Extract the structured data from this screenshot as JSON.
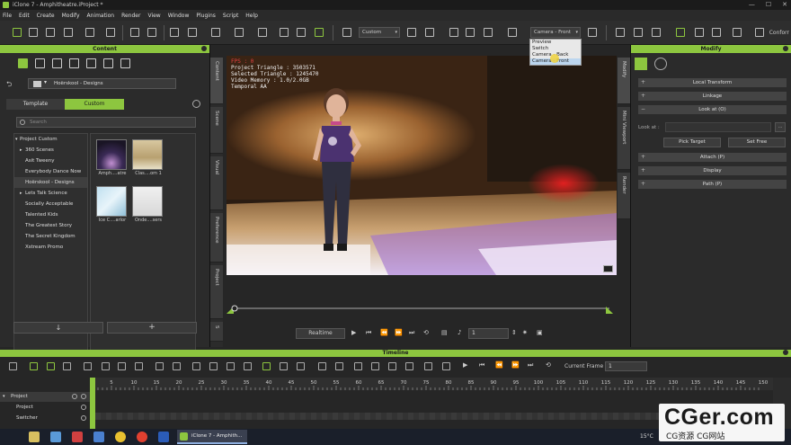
{
  "window": {
    "title": "iClone 7 - Amphitheatre.iProject *",
    "controls": [
      "—",
      "☐",
      "✕"
    ]
  },
  "menu": [
    "File",
    "Edit",
    "Create",
    "Modify",
    "Animation",
    "Render",
    "View",
    "Window",
    "Plugins",
    "Script",
    "Help"
  ],
  "toolbar": {
    "view_mode": "Custom",
    "camera": "Camera - Front",
    "conform_label": "Conforr",
    "camera_options": [
      "Preview",
      "Switch",
      "Camera - Back",
      "Camera - Front"
    ],
    "accent": "#8dc63f"
  },
  "content_panel": {
    "title": "Content",
    "path": "Hoërskool - Designs",
    "tabs": [
      "Template",
      "Custom"
    ],
    "active_tab": "Custom",
    "search_placeholder": "Search",
    "tree": [
      {
        "label": "Project Custom",
        "expander": "▾",
        "level": 0
      },
      {
        "label": "360 Scenes",
        "expander": "▸",
        "level": 1
      },
      {
        "label": "Asit Tweeny",
        "expander": "",
        "level": 1
      },
      {
        "label": "Everybody Dance Now",
        "expander": "",
        "level": 1
      },
      {
        "label": "Hoërskool - Designs",
        "expander": "",
        "level": 1,
        "selected": true
      },
      {
        "label": "Lets Talk Science",
        "expander": "▸",
        "level": 1
      },
      {
        "label": "Socially Acceptable",
        "expander": "",
        "level": 1
      },
      {
        "label": "Talented Kids",
        "expander": "",
        "level": 1
      },
      {
        "label": "The Greatest Story",
        "expander": "",
        "level": 1
      },
      {
        "label": "The Secret Kingdom",
        "expander": "",
        "level": 1
      },
      {
        "label": "Xstream Promo",
        "expander": "",
        "level": 1
      }
    ],
    "thumbnails": [
      {
        "caption": "Amph....atre"
      },
      {
        "caption": "Clas....om 1"
      },
      {
        "caption": "Ice C....arlor"
      },
      {
        "caption": "Onde....sers"
      }
    ],
    "down_button": "↓",
    "add_button": "+"
  },
  "side_tabs": [
    "Content",
    "Scene",
    "Visual",
    "Preference",
    "Project",
    "S"
  ],
  "viewport": {
    "stats": [
      "FPS : 0",
      "Project Triangle : 3503571",
      "Selected Triangle : 1245470",
      "Video Memory : 1.0/2.0GB",
      "Temporal AA"
    ]
  },
  "playback": {
    "realtime_label": "Realtime",
    "frame": "1"
  },
  "modify_panel": {
    "title": "Modify",
    "vtabs": [
      "Modify",
      "Mini Viewport",
      "Render"
    ],
    "sections": [
      {
        "label": "Local Transform",
        "sign": "+"
      },
      {
        "label": "Linkage",
        "sign": "+"
      },
      {
        "label": "Look at  (O)",
        "sign": "−"
      }
    ],
    "look_at_label": "Look at :",
    "look_at_more": "...",
    "pick_target": "Pick Target",
    "set_free": "Set Free",
    "more_sections": [
      {
        "label": "Attach  (P)",
        "sign": "+"
      },
      {
        "label": "Display",
        "sign": "+"
      },
      {
        "label": "Path  (P)",
        "sign": "+"
      }
    ]
  },
  "timeline": {
    "title": "Timeline",
    "current_frame_label": "Current Frame :",
    "current_frame": "1",
    "ruler": [
      "5",
      "10",
      "15",
      "20",
      "25",
      "30",
      "35",
      "40",
      "45",
      "50",
      "55",
      "60",
      "65",
      "70",
      "75",
      "80",
      "85",
      "90",
      "95",
      "100",
      "105",
      "110",
      "115",
      "120",
      "125",
      "130",
      "135",
      "140",
      "145",
      "150"
    ],
    "tracks": [
      "Project",
      "Project",
      "Switcher"
    ]
  },
  "taskbar": {
    "app_label": "iClone 7 - Amphith...",
    "weather": "15°C"
  },
  "watermark": {
    "main": "CGer.com",
    "sub": "CG资源 CG网站"
  }
}
